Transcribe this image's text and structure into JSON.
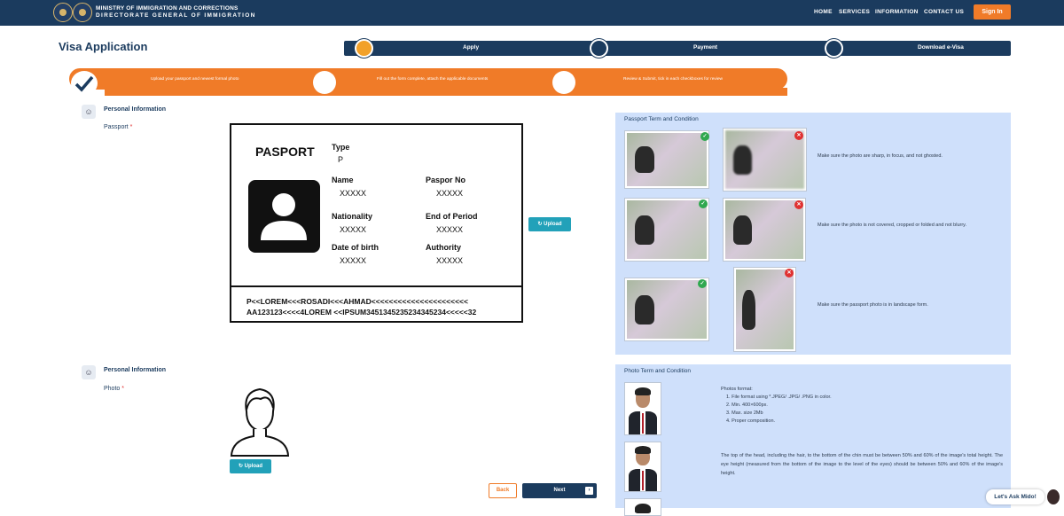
{
  "header": {
    "ministry": "MINISTRY OF IMMIGRATION AND CORRECTIONS",
    "directorate": "DIRECTORATE GENERAL OF IMMIGRATION",
    "nav": [
      "HOME",
      "SERVICES",
      "INFORMATION",
      "CONTACT US"
    ],
    "sign_in": "Sign In"
  },
  "page_title": "Visa Application",
  "steps": [
    "Apply",
    "Payment",
    "Download e-Visa"
  ],
  "substeps": [
    "Upload your passport and newest formal photo",
    "Fill out the form complete, attach the applicable documents",
    "Review & Submit, tick in each checkboxes for review"
  ],
  "passport_section": {
    "title": "Personal Information",
    "label": "Passport",
    "required": "*",
    "card": {
      "heading": "PASPORT",
      "type_label": "Type",
      "type_value": "P",
      "name_label": "Name",
      "name_value": "XXXXX",
      "no_label": "Paspor No",
      "no_value": "XXXXX",
      "nat_label": "Nationality",
      "nat_value": "XXXXX",
      "end_label": "End of Period",
      "end_value": "XXXXX",
      "dob_label": "Date of birth",
      "dob_value": "XXXXX",
      "auth_label": "Authority",
      "auth_value": "XXXXX",
      "mrz1": "P<<LOREM<<<ROSADI<<<AHMAD<<<<<<<<<<<<<<<<<<<<<<",
      "mrz2": "AA123123<<<<4LOREM <<IPSUM3451345235234345234<<<<<32"
    },
    "upload": "Upload"
  },
  "passport_terms": {
    "title": "Passport Term and Condition",
    "hints": [
      "Make sure the photo are sharp, in focus, and not ghosted.",
      "Make sure the photo is not covered, cropped or folded and not blurry.",
      "Make sure the passport photo is in landscape form."
    ]
  },
  "photo_section": {
    "title": "Personal Information",
    "label": "Photo",
    "required": "*",
    "upload": "Upload"
  },
  "photo_terms": {
    "title": "Photo Term and Condition",
    "format_title": "Photos format:",
    "format_items": [
      "1. File format using *.JPEG/ .JPG/ .PNG in color.",
      "2. Min. 400×600px.",
      "3. Max. size 2Mb",
      "4. Proper composition."
    ],
    "paragraph": "The top of the head, including the hair, to the bottom of the chin must be between 50% and 60% of the image's total height. The eye height (measured from the bottom of the image to the level of the eyes) should be between 50% and 60% of the image's height."
  },
  "buttons": {
    "back": "Back",
    "next": "Next"
  },
  "chat": "Let's Ask Mido!",
  "icons": {
    "check_ok": "✓",
    "check_bad": "✕",
    "upload": "↻",
    "next_arrow": "›",
    "person": "☺"
  },
  "colors": {
    "navy": "#1b3b5e",
    "orange": "#f07b28",
    "teal": "#22a1b9",
    "panel": "#cfe0fb"
  }
}
